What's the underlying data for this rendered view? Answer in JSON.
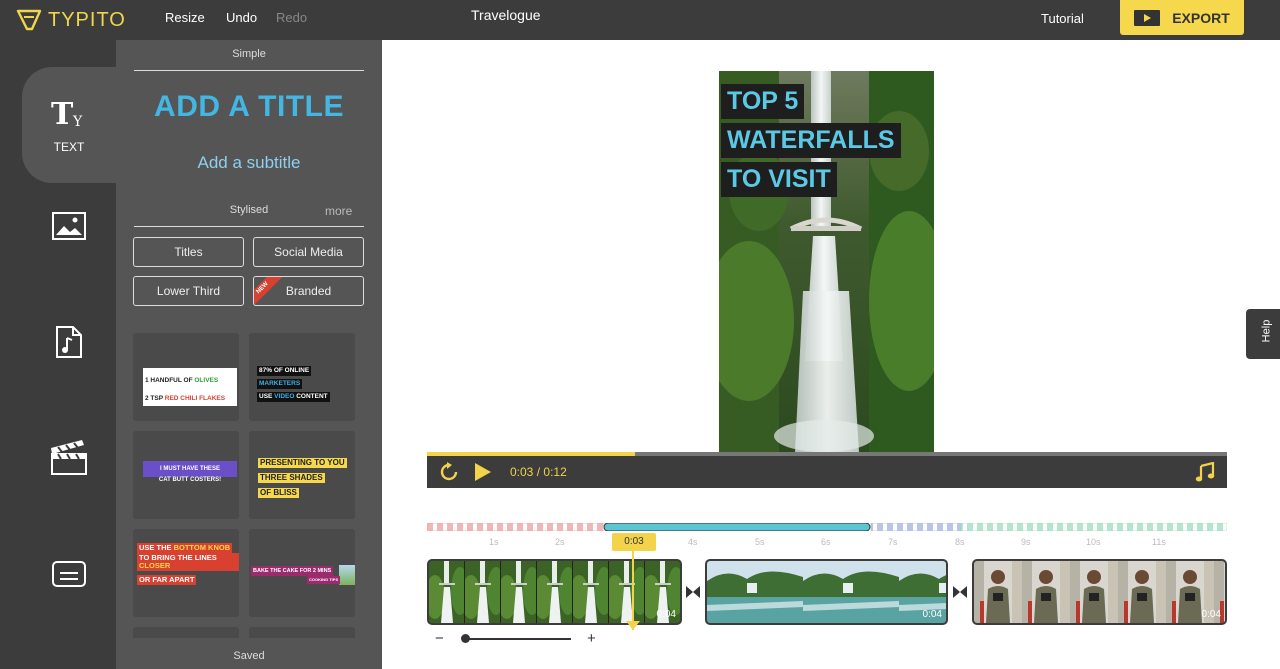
{
  "app": {
    "brand": "TYPITO",
    "project_title": "Travelogue",
    "accent_color": "#f5d84b"
  },
  "toolbar": {
    "resize": "Resize",
    "undo": "Undo",
    "redo": "Redo",
    "tutorial": "Tutorial",
    "export": "EXPORT"
  },
  "rail": {
    "items": [
      {
        "label": "TEXT",
        "icon": "text-icon",
        "active": true
      },
      {
        "label": "",
        "icon": "image-icon"
      },
      {
        "label": "",
        "icon": "music-file-icon"
      },
      {
        "label": "",
        "icon": "clapperboard-icon"
      },
      {
        "label": "",
        "icon": "caption-icon"
      }
    ]
  },
  "panel": {
    "simple_header": "Simple",
    "add_title": "ADD A TITLE",
    "add_subtitle": "Add a subtitle",
    "stylised_header": "Stylised",
    "more": "more",
    "categories": [
      "Titles",
      "Social Media",
      "Lower Third",
      "Branded"
    ],
    "new_badge": "NEW",
    "saved_header": "Saved",
    "templates": [
      {
        "lines": [
          [
            "1 HANDFUL OF ",
            "OLIVES"
          ],
          [
            "2 TSP ",
            "RED CHILI FLAKES"
          ]
        ]
      },
      {
        "lines": [
          "87% OF ONLINE",
          "MARKETERS",
          [
            "USE ",
            "VIDEO",
            " CONTENT"
          ]
        ]
      },
      {
        "lines": [
          "I MUST HAVE THESE",
          "CAT BUTT COSTERS!"
        ]
      },
      {
        "lines": [
          "PRESENTING TO YOU",
          "THREE SHADES",
          "OF BLISS"
        ]
      },
      {
        "lines": [
          [
            "USE THE ",
            "BOTTOM KNOB"
          ],
          [
            "TO BRING THE LINES ",
            "CLOSER"
          ],
          "OR FAR APART"
        ]
      },
      {
        "lines": [
          "BAKE THE CAKE FOR 2 MINS",
          "COOKING TIPS"
        ]
      }
    ]
  },
  "preview": {
    "title_lines": [
      "TOP 5",
      "WATERFALLS",
      "TO VISIT"
    ],
    "title_color": "#5cc9e4"
  },
  "player": {
    "current_time": "0:03",
    "separator": "/",
    "total_time": "0:12",
    "progress": 0.26
  },
  "timeline": {
    "ticks": [
      "1s",
      "2s",
      "3s",
      "4s",
      "5s",
      "6s",
      "7s",
      "8s",
      "9s",
      "10s",
      "11s"
    ],
    "playhead_label": "0:03",
    "clips": [
      {
        "duration": "0:04",
        "scene": "waterfall"
      },
      {
        "duration": "0:04",
        "scene": "lake"
      },
      {
        "duration": "0:04",
        "scene": "photographer"
      }
    ],
    "zoom_minus": "−",
    "zoom_plus": "+"
  },
  "help": {
    "label": "Help"
  }
}
